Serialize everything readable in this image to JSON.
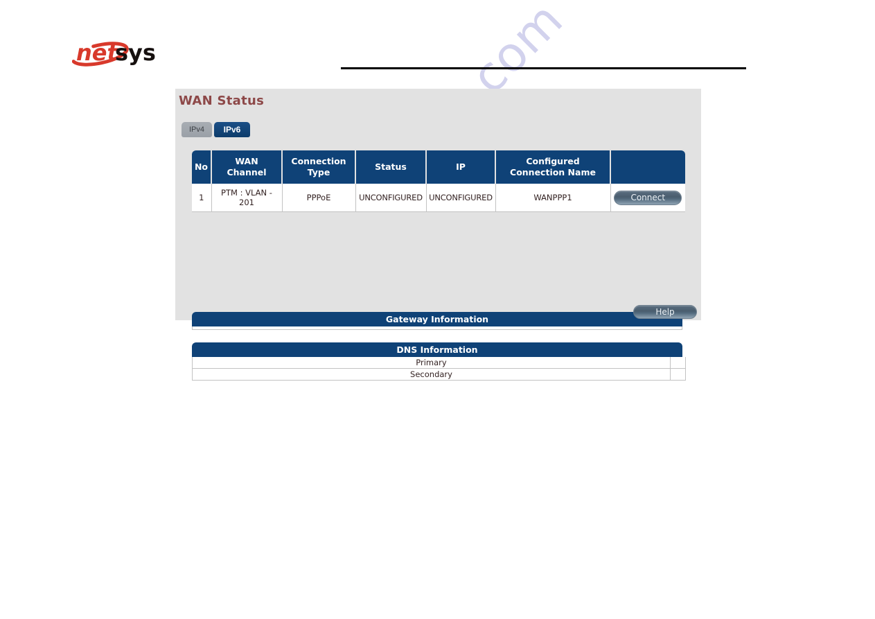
{
  "brand": {
    "logo_text_red": "net",
    "logo_text_black": "sys",
    "logo_name": "netsys"
  },
  "watermark": {
    "text": "manualshive.com"
  },
  "panel": {
    "title": "WAN Status",
    "title_color": "#8d4848",
    "background": "#e2e2e2"
  },
  "tabs": [
    {
      "label": "IPv4",
      "active": false
    },
    {
      "label": "IPv6",
      "active": true
    }
  ],
  "wan_table": {
    "accent_color": "#0f4277",
    "headers": [
      "No",
      "WAN Channel",
      "Connection Type",
      "Status",
      "IP",
      "Configured Connection Name",
      ""
    ],
    "rows": [
      {
        "no": "1",
        "wan_channel": "PTM : VLAN - 201",
        "connection_type": "PPPoE",
        "status": "UNCONFIGURED",
        "ip": "UNCONFIGURED",
        "configured_connection_name": "WANPPP1",
        "action_label": "Connect"
      }
    ]
  },
  "gateway": {
    "title": "Gateway Information",
    "value": ""
  },
  "dns": {
    "title": "DNS Information",
    "rows": [
      {
        "label": "Primary",
        "value": ""
      },
      {
        "label": "Secondary",
        "value": ""
      }
    ]
  },
  "footer": {
    "help_label": "Help"
  }
}
